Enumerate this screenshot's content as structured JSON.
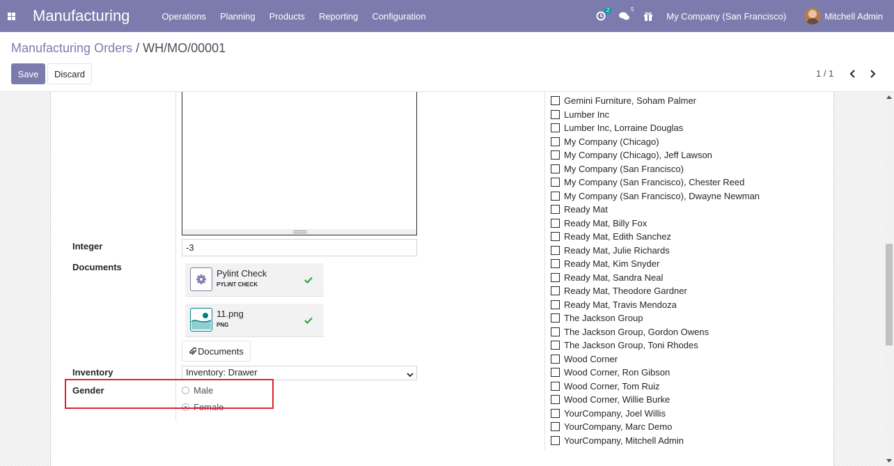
{
  "navbar": {
    "app_name": "Manufacturing",
    "menu": [
      "Operations",
      "Planning",
      "Products",
      "Reporting",
      "Configuration"
    ],
    "activity_count": "2",
    "messages_count": "5",
    "company": "My Company (San Francisco)",
    "user": "Mitchell Admin",
    "color": "#7c7bad"
  },
  "breadcrumb": {
    "parent": "Manufacturing Orders",
    "separator": "/",
    "current": "WH/MO/00001"
  },
  "buttons": {
    "save": "Save",
    "discard": "Discard"
  },
  "pager": {
    "value": "1 / 1"
  },
  "form": {
    "integer_label": "Integer",
    "integer_value": "-3",
    "documents_label": "Documents",
    "documents": [
      {
        "name": "Pylint Check",
        "ext": "PYLINT CHECK",
        "icon": "gear-icon"
      },
      {
        "name": "11.png",
        "ext": "PNG",
        "icon": "image-icon"
      }
    ],
    "documents_button": "Documents",
    "inventory_label": "Inventory",
    "inventory_value": "Inventory: Drawer",
    "gender_label": "Gender",
    "gender_options": [
      "Male",
      "Female"
    ],
    "gender_selected": "Female"
  },
  "partners": [
    "Gemini Furniture, Soham Palmer",
    "Lumber Inc",
    "Lumber Inc, Lorraine Douglas",
    "My Company (Chicago)",
    "My Company (Chicago), Jeff Lawson",
    "My Company (San Francisco)",
    "My Company (San Francisco), Chester Reed",
    "My Company (San Francisco), Dwayne Newman",
    "Ready Mat",
    "Ready Mat, Billy Fox",
    "Ready Mat, Edith Sanchez",
    "Ready Mat, Julie Richards",
    "Ready Mat, Kim Snyder",
    "Ready Mat, Sandra Neal",
    "Ready Mat, Theodore Gardner",
    "Ready Mat, Travis Mendoza",
    "The Jackson Group",
    "The Jackson Group, Gordon Owens",
    "The Jackson Group, Toni Rhodes",
    "Wood Corner",
    "Wood Corner, Ron Gibson",
    "Wood Corner, Tom Ruiz",
    "Wood Corner, Willie Burke",
    "YourCompany, Joel Willis",
    "YourCompany, Marc Demo",
    "YourCompany, Mitchell Admin"
  ]
}
